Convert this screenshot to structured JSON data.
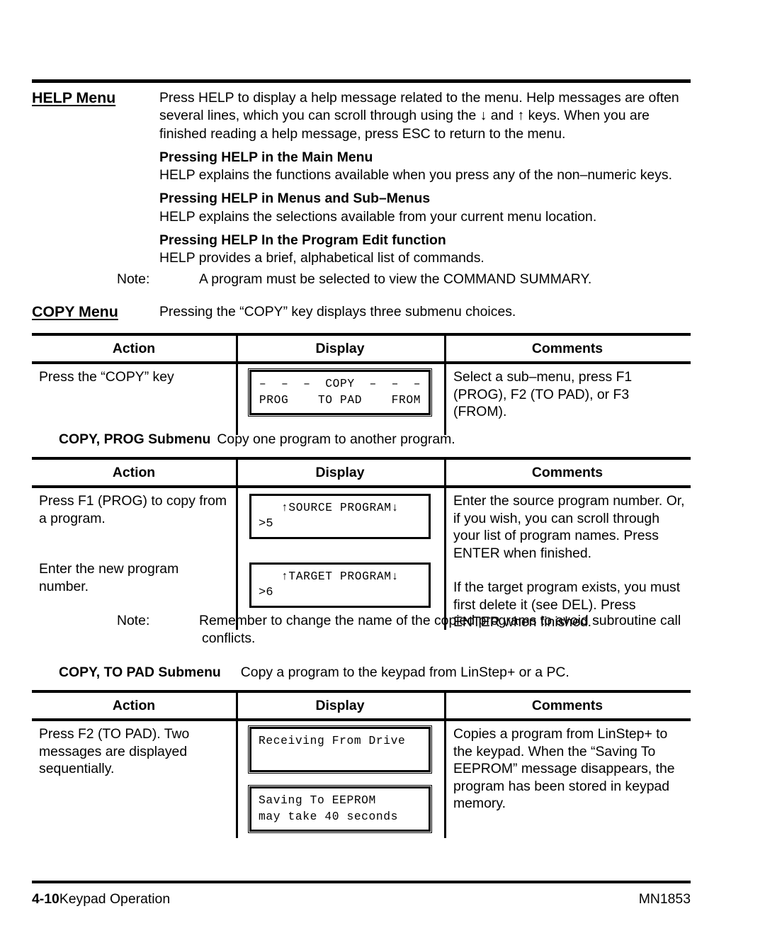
{
  "help_section": {
    "heading": "HELP Menu",
    "intro": "Press HELP to display a help message related to the menu. Help messages are often several lines, which you can scroll through using the ↓ and ↑ keys. When you are finished reading a help message, press ESC to return to the menu.",
    "sub1_heading": "Pressing HELP in the Main Menu",
    "sub1_body": "HELP explains the functions available when you press any of the non–numeric keys.",
    "sub2_heading": "Pressing HELP in Menus and Sub–Menus",
    "sub2_body": "HELP explains the selections available from your current menu location.",
    "sub3_heading": "Pressing HELP In the Program Edit function",
    "sub3_body": "HELP provides a brief, alphabetical list of commands."
  },
  "note_command_summary": {
    "lead": "Note:",
    "text": "A program must be selected to view the COMMAND SUMMARY."
  },
  "copy_section": {
    "heading": "COPY Menu",
    "intro": "Pressing the “COPY” key displays three submenu choices."
  },
  "table_columns": {
    "action": "Action",
    "display": "Display",
    "comments": "Comments"
  },
  "table_copy_menu": {
    "rows": [
      {
        "action": "Press the “COPY” key",
        "display": {
          "style": "double",
          "line1": "–  –  –  COPY  –  –  –",
          "line2": "PROG    TO PAD    FROM"
        },
        "comments": "Select a sub–menu, press F1 (PROG), F2 (TO PAD), or F3 (FROM)."
      }
    ]
  },
  "submenu_prog": {
    "title": "COPY, PROG Submenu",
    "description": "Copy one program to another program."
  },
  "table_copy_prog": {
    "rows": [
      {
        "action": "Press F1 (PROG) to copy from a program.",
        "display": {
          "style": "single",
          "line1": "↑SOURCE PROGRAM↓",
          "line2": ">5"
        },
        "comments": "Enter the source program number. Or, if you wish, you can scroll through your list of program names. Press ENTER when finished."
      },
      {
        "action": "Enter the new program number.",
        "display": {
          "style": "single",
          "line1": "↑TARGET PROGRAM↓",
          "line2": ">6"
        },
        "comments": "If the target program exists, you must first delete it (see DEL). Press ENTER when finished."
      }
    ]
  },
  "note_subroutine": {
    "lead": "Note:",
    "text": "Remember to change the name of the copied programs to avoid subroutine call conflicts."
  },
  "submenu_topad": {
    "title": "COPY, TO PAD Submenu",
    "description": "Copy a program to the keypad from LinStep+ or a PC."
  },
  "table_copy_topad": {
    "rows": [
      {
        "action": "Press F2 (TO PAD). Two messages are displayed sequentially.",
        "display1": {
          "style": "double",
          "line1": "Receiving From Drive",
          "line2": ""
        },
        "display2": {
          "style": "double",
          "line1": "Saving To EEPROM",
          "line2": "may take 40 seconds"
        },
        "comments": "Copies a program from LinStep+ to the keypad.  When the “Saving To EEPROM” message disappears, the program has been stored in keypad memory."
      }
    ]
  },
  "footer": {
    "page_number": "4-10",
    "section_title": "Keypad Operation",
    "doc_number": "MN1853"
  }
}
